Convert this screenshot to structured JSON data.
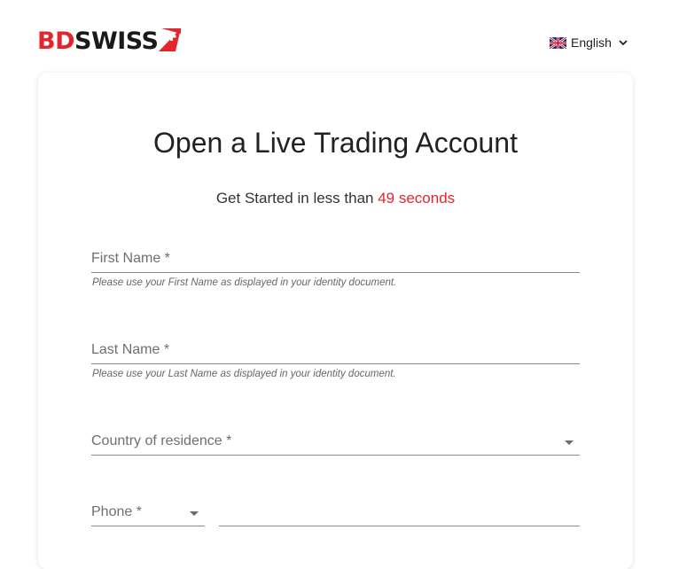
{
  "header": {
    "logo": {
      "part1": "BD",
      "part2": "SWISS",
      "cross_icon": "swiss-cross-icon"
    },
    "language": {
      "label": "English",
      "flag_icon": "uk-flag-icon",
      "chevron_icon": "chevron-down-icon"
    }
  },
  "form": {
    "title": "Open a Live Trading Account",
    "subtitle_prefix": "Get Started in less than ",
    "subtitle_highlight": "49 seconds",
    "fields": {
      "first_name": {
        "label": "First Name *",
        "helper": "Please use your First Name as displayed in your identity document."
      },
      "last_name": {
        "label": "Last Name *",
        "helper": "Please use your Last Name as displayed in your identity document."
      },
      "country": {
        "label": "Country of residence *"
      },
      "phone_code": {
        "label": "Phone *"
      },
      "phone_number": {
        "label": ""
      }
    }
  },
  "colors": {
    "brand_red": "#e3262e",
    "text_dark": "#212121",
    "label_gray": "#6f6f6f"
  }
}
